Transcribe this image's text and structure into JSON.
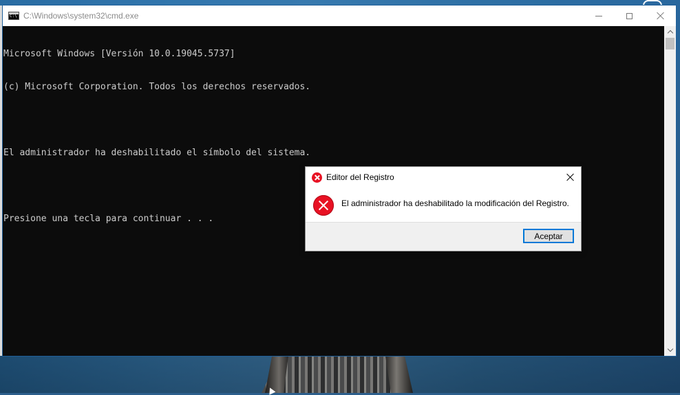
{
  "cmd_window": {
    "title": "C:\\Windows\\system32\\cmd.exe",
    "console_lines": [
      "Microsoft Windows [Versión 10.0.19045.5737]",
      "(c) Microsoft Corporation. Todos los derechos reservados.",
      "",
      "El administrador ha deshabilitado el símbolo del sistema.",
      "",
      "Presione una tecla para continuar . . ."
    ]
  },
  "dialog": {
    "title": "Editor del Registro",
    "message": "El administrador ha deshabilitado la modificación del Registro.",
    "ok_label": "Aceptar"
  },
  "colors": {
    "console_bg": "#0c0c0c",
    "console_text": "#cccccc",
    "error_red": "#e81123",
    "accent_blue": "#0078d7"
  },
  "icons": {
    "cmd_app": "cmd-app-icon",
    "minimize": "minimize-icon",
    "maximize": "maximize-icon",
    "close": "close-icon",
    "error": "error-icon"
  }
}
